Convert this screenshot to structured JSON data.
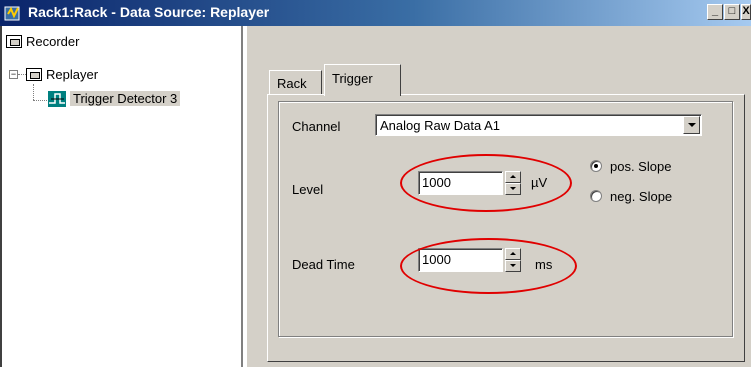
{
  "window": {
    "title": "Rack1:Rack - Data Source: Replayer",
    "minimize": "_",
    "maximize": "□",
    "close": "X"
  },
  "tree": {
    "items": [
      {
        "label": "Recorder",
        "icon": "recorder-icon"
      },
      {
        "label": "Replayer",
        "icon": "replayer-icon",
        "expander": "−"
      },
      {
        "label": "Trigger Detector 3",
        "icon": "trigger-detector-icon"
      }
    ]
  },
  "tabs": [
    {
      "label": "Rack",
      "active": false
    },
    {
      "label": "Trigger",
      "active": true
    }
  ],
  "trigger": {
    "channel_label": "Channel",
    "channel_value": "Analog Raw Data A1",
    "level_label": "Level",
    "level_value": "1000",
    "level_unit": "µV",
    "dead_time_label": "Dead Time",
    "dead_time_value": "1000",
    "dead_time_unit": "ms",
    "slope_options": [
      {
        "label": "pos. Slope",
        "checked": true
      },
      {
        "label": "neg. Slope",
        "checked": false
      }
    ]
  },
  "colors": {
    "highlight_ellipse": "#e00000",
    "titlebar_start": "#0a246a",
    "titlebar_end": "#a6caf0"
  }
}
